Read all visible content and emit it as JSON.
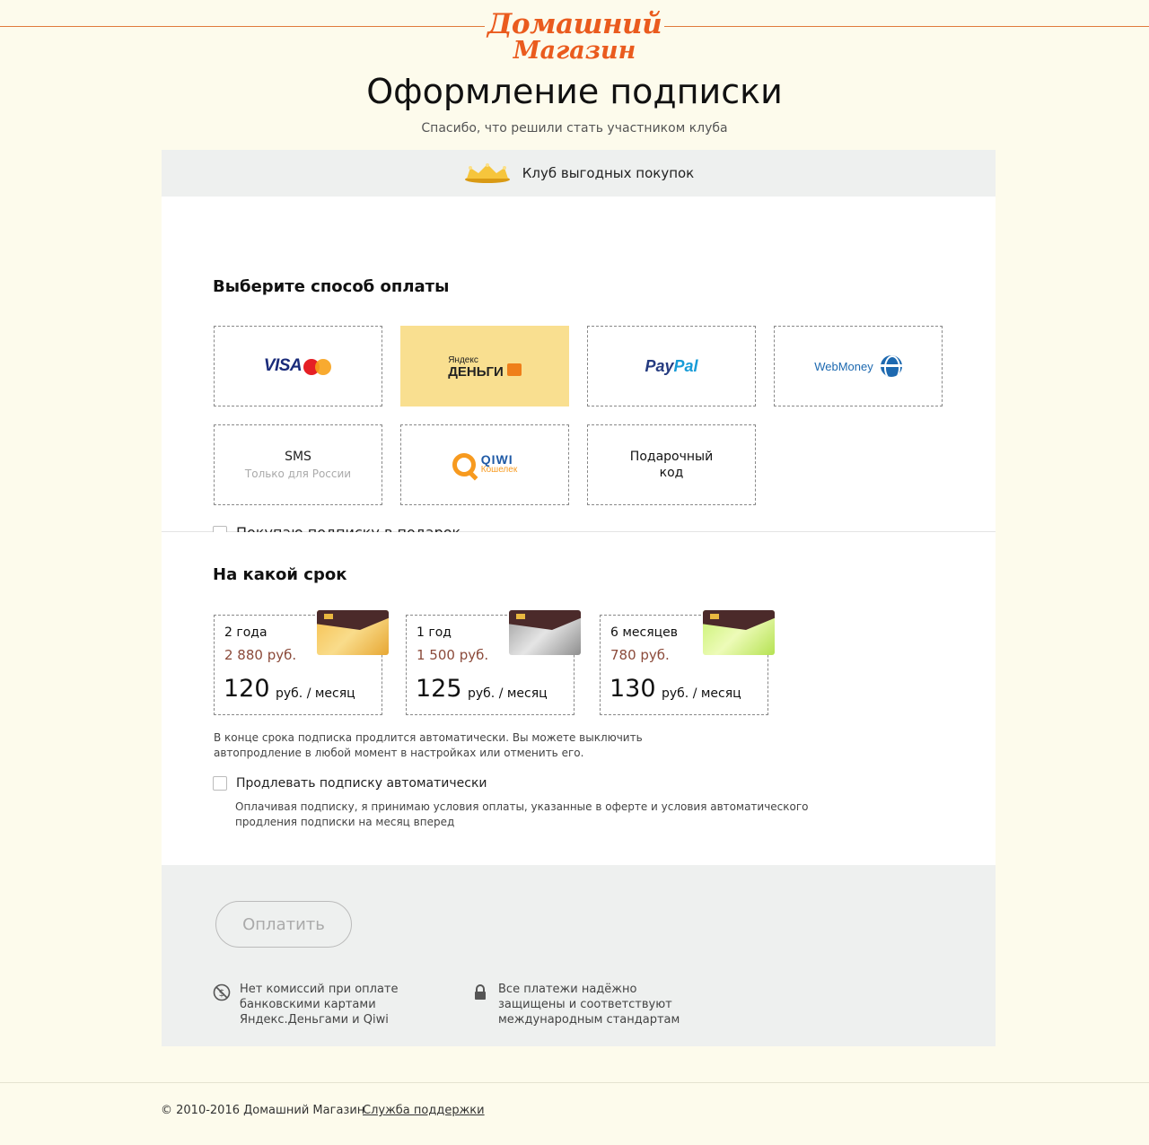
{
  "header": {
    "logo_line1": "Домашний",
    "logo_line2": "Магазин",
    "title": "Оформление подписки",
    "subtitle": "Спасибо, что решили стать участником клуба"
  },
  "club": {
    "label": "Клуб выгодных покупок",
    "icon": "crown-icon"
  },
  "payment": {
    "heading": "Выберите способ оплаты",
    "methods": [
      {
        "id": "visa-mastercard",
        "label": "VISA",
        "sub": "MasterCard",
        "selected": false
      },
      {
        "id": "yandex-money",
        "label": "Яндекс",
        "sub": "ДЕНЬГИ",
        "selected": true
      },
      {
        "id": "paypal",
        "label": "Pay",
        "sub": "Pal",
        "selected": false
      },
      {
        "id": "webmoney",
        "label": "WebMoney",
        "selected": false
      },
      {
        "id": "sms",
        "label": "SMS",
        "sub": "Только для России",
        "selected": false
      },
      {
        "id": "qiwi",
        "label": "QIWI",
        "sub": "Кошелек",
        "selected": false
      },
      {
        "id": "gift-code",
        "label": "Подарочный",
        "sub": "код",
        "selected": false
      }
    ],
    "gift_checkbox": {
      "label": "Покупаю подписку в подарок",
      "checked": false
    }
  },
  "term": {
    "heading": "На какой срок",
    "options": [
      {
        "period": "2 года",
        "total": "2 880 руб.",
        "price": "120",
        "unit": "руб. / месяц",
        "card": "gold"
      },
      {
        "period": "1 год",
        "total": "1 500 руб.",
        "price": "125",
        "unit": "руб. / месяц",
        "card": "silver"
      },
      {
        "period": "6 месяцев",
        "total": "780 руб.",
        "price": "130",
        "unit": "руб. / месяц",
        "card": "green"
      }
    ],
    "renew_note": "В конце срока подписка продлится автоматически. Вы можете выключить автопродление в любой момент в настройках или отменить его.",
    "auto_checkbox": {
      "label": "Продлевать подписку автоматически",
      "checked": false
    },
    "terms_note": "Оплачивая подписку, я принимаю условия оплаты, указанные в оферте и условия автоматического продления подписки на месяц вперед"
  },
  "checkout": {
    "pay_button": "Оплатить",
    "info1": "Нет комиссий при оплате банковскими картами Яндекс.Деньгами и Qiwi",
    "info2": "Все платежи надёжно защищены и соответствуют международным стандартам"
  },
  "footer": {
    "copyright": "© 2010-2016 Домашний Магазин",
    "support": "Служба поддержки"
  },
  "colors": {
    "accent": "#ea5b1e",
    "selected": "#f9df90",
    "panel": "#eef0ef",
    "background": "#fdfbec"
  }
}
